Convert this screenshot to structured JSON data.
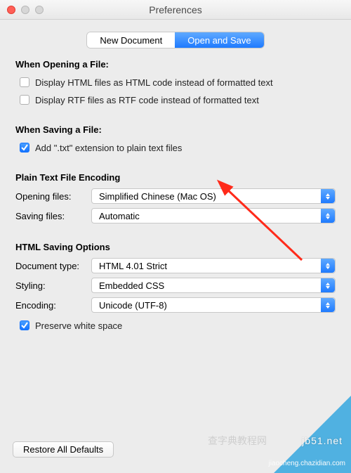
{
  "window": {
    "title": "Preferences"
  },
  "tabs": {
    "newDocument": "New Document",
    "openAndSave": "Open and Save"
  },
  "openingSection": {
    "title": "When Opening a File:",
    "displayHtml": "Display HTML files as HTML code instead of formatted text",
    "displayRtf": "Display RTF files as RTF code instead of formatted text"
  },
  "savingSection": {
    "title": "When Saving a File:",
    "addTxt": "Add \".txt\" extension to plain text files"
  },
  "encodingSection": {
    "title": "Plain Text File Encoding",
    "openingLabel": "Opening files:",
    "openingValue": "Simplified Chinese (Mac OS)",
    "savingLabel": "Saving files:",
    "savingValue": "Automatic"
  },
  "htmlSection": {
    "title": "HTML Saving Options",
    "docTypeLabel": "Document type:",
    "docTypeValue": "HTML 4.01 Strict",
    "stylingLabel": "Styling:",
    "stylingValue": "Embedded CSS",
    "encodingLabel": "Encoding:",
    "encodingValue": "Unicode (UTF-8)",
    "preserve": "Preserve white space"
  },
  "buttons": {
    "restore": "Restore All Defaults"
  },
  "watermark": {
    "site1": "jb51.net",
    "site2": "jiaocheng.chazidian.com",
    "cn": "查字典教程网"
  }
}
